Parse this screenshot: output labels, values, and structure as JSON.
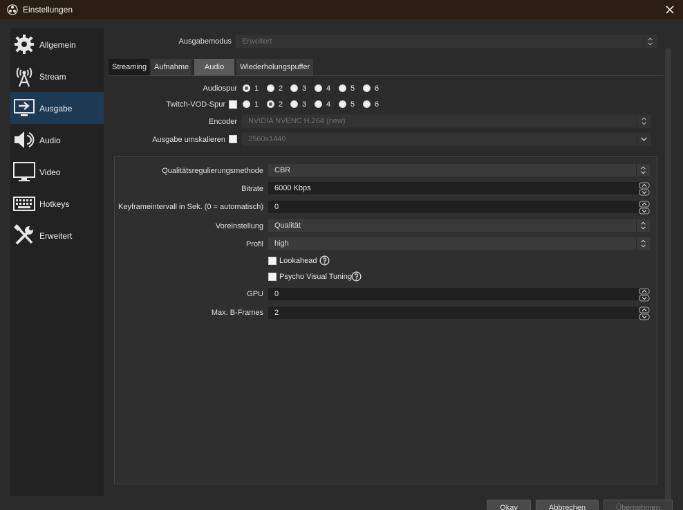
{
  "window": {
    "title": "Einstellungen",
    "close_label": "×"
  },
  "sidebar": {
    "items": [
      {
        "label": "Allgemein",
        "icon": "gear-icon"
      },
      {
        "label": "Stream",
        "icon": "broadcast-icon"
      },
      {
        "label": "Ausgabe",
        "icon": "output-monitor-icon"
      },
      {
        "label": "Audio",
        "icon": "speaker-icon"
      },
      {
        "label": "Video",
        "icon": "monitor-icon"
      },
      {
        "label": "Hotkeys",
        "icon": "keyboard-icon"
      },
      {
        "label": "Erweitert",
        "icon": "tools-icon"
      }
    ],
    "active": "Ausgabe"
  },
  "output_mode": {
    "label": "Ausgabemodus",
    "value": "Erweitert"
  },
  "tabs": [
    {
      "label": "Streaming"
    },
    {
      "label": "Aufnahme"
    },
    {
      "label": "Audio"
    },
    {
      "label": "Wiederholungspuffer"
    }
  ],
  "audio_track": {
    "label": "Audiospur",
    "options": [
      "1",
      "2",
      "3",
      "4",
      "5",
      "6"
    ],
    "selected": "1"
  },
  "twitch_vod": {
    "label": "Twitch-VOD-Spur",
    "options": [
      "1",
      "2",
      "3",
      "4",
      "5",
      "6"
    ],
    "selected": "2"
  },
  "encoder": {
    "label": "Encoder",
    "value": "NVIDIA NVENC H.264 (new)"
  },
  "rescale": {
    "label": "Ausgabe umskalieren",
    "value": "2560x1440"
  },
  "encoder_settings": {
    "rate_control": {
      "label": "Qualitätsregulierungsmethode",
      "value": "CBR"
    },
    "bitrate": {
      "label": "Bitrate",
      "value": "6000 Kbps"
    },
    "keyframe": {
      "label": "Keyframeintervall in Sek. (0 = automatisch)",
      "value": "0"
    },
    "preset": {
      "label": "Voreinstellung",
      "value": "Qualität"
    },
    "profile": {
      "label": "Profil",
      "value": "high"
    },
    "lookahead": {
      "label": "Lookahead"
    },
    "psycho": {
      "label": "Psycho Visual Tuning"
    },
    "gpu": {
      "label": "GPU",
      "value": "0"
    },
    "bframes": {
      "label": "Max. B-Frames",
      "value": "2"
    }
  },
  "buttons": {
    "ok": "Okay",
    "cancel": "Abbrechen",
    "apply": "Übernehmen"
  },
  "colors": {
    "titlebar": "#2a1f12",
    "active_sidebar": "#1e3a52",
    "window_bg": "#2b2b2b"
  }
}
